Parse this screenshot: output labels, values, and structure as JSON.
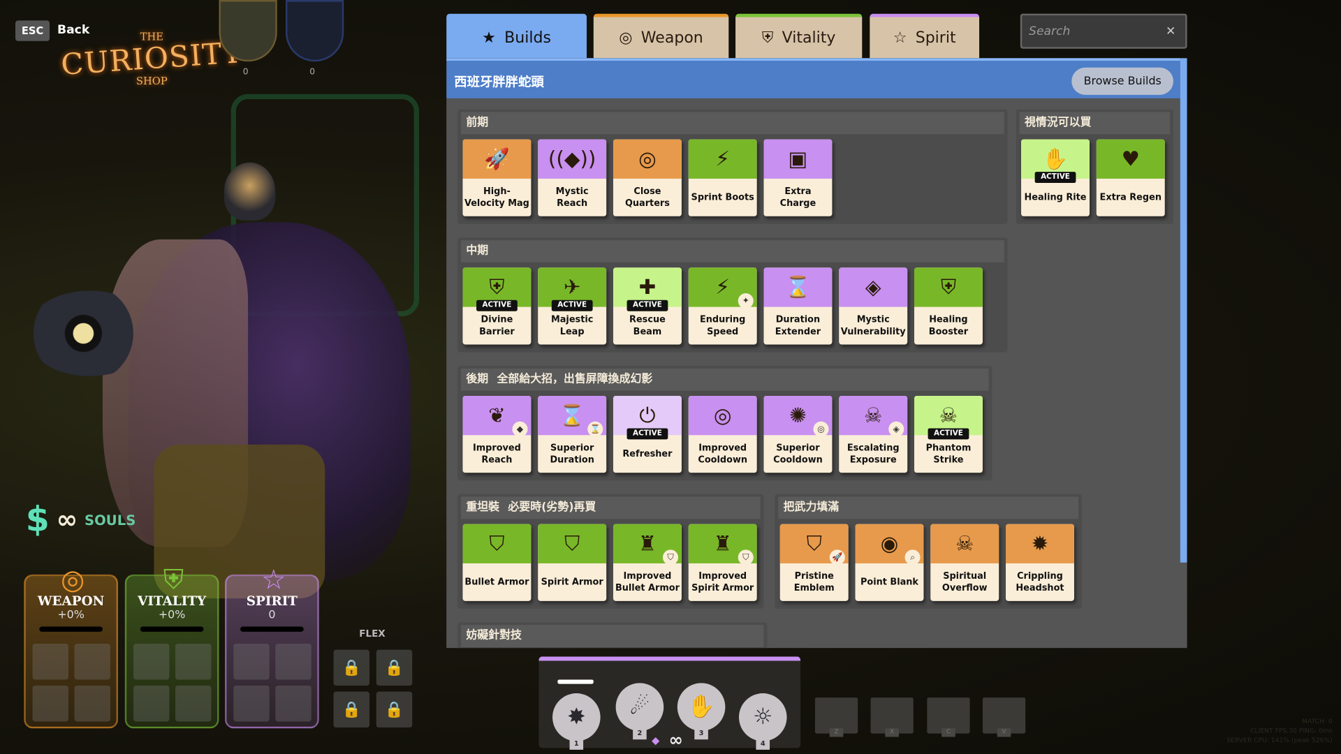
{
  "nav": {
    "esc_key": "ESC",
    "back_label": "Back"
  },
  "logo": {
    "line1": "THE",
    "line2": "CURIOSITY",
    "line3": "SHOP"
  },
  "portraits": [
    {
      "count": "0"
    },
    {
      "count": "0"
    }
  ],
  "hud": {
    "souls_label": "SOULS",
    "flex_label": "FLEX",
    "stats": [
      {
        "name": "WEAPON",
        "value": "+0%",
        "color": "#e8962a"
      },
      {
        "name": "VITALITY",
        "value": "+0%",
        "color": "#7cc23a"
      },
      {
        "name": "SPIRIT",
        "value": "0",
        "color": "#c88ef0"
      }
    ]
  },
  "tabs": [
    {
      "label": "Builds",
      "icon": "star-icon",
      "active": true
    },
    {
      "label": "Weapon",
      "icon": "weapon-icon",
      "color": "#e8962a"
    },
    {
      "label": "Vitality",
      "icon": "vitality-icon",
      "color": "#7cc23a"
    },
    {
      "label": "Spirit",
      "icon": "spirit-icon",
      "color": "#c88ef0"
    }
  ],
  "search": {
    "placeholder": "Search"
  },
  "build": {
    "title": "西班牙胖胖蛇頭",
    "browse_label": "Browse Builds"
  },
  "sections": [
    {
      "title": "前期",
      "note": "",
      "items": [
        {
          "name": "High-Velocity Mag",
          "cat": "w",
          "icon": "🚀"
        },
        {
          "name": "Mystic Reach",
          "cat": "s",
          "icon": "((◆))"
        },
        {
          "name": "Close Quarters",
          "cat": "w",
          "icon": "◎"
        },
        {
          "name": "Sprint Boots",
          "cat": "v",
          "icon": "⚡"
        },
        {
          "name": "Extra Charge",
          "cat": "s",
          "icon": "▣"
        }
      ]
    },
    {
      "title": "視情況可以買",
      "note": "",
      "items": [
        {
          "name": "Healing Rite",
          "cat": "v",
          "icon": "✋",
          "active": true,
          "light": true
        },
        {
          "name": "Extra Regen",
          "cat": "v",
          "icon": "♥"
        }
      ]
    },
    {
      "title": "中期",
      "note": "",
      "items": [
        {
          "name": "Divine Barrier",
          "cat": "v",
          "icon": "⛨",
          "active": true
        },
        {
          "name": "Majestic Leap",
          "cat": "v",
          "icon": "✈",
          "active": true
        },
        {
          "name": "Rescue Beam",
          "cat": "v",
          "icon": "✚",
          "active": true,
          "light": true
        },
        {
          "name": "Enduring Speed",
          "cat": "v",
          "icon": "⚡",
          "badge": "✦"
        },
        {
          "name": "Duration Extender",
          "cat": "s",
          "icon": "⌛"
        },
        {
          "name": "Mystic Vulnerability",
          "cat": "s",
          "icon": "◈"
        },
        {
          "name": "Healing Booster",
          "cat": "v",
          "icon": "⛨"
        }
      ]
    },
    {
      "title": "後期",
      "note": "全部給大招，出售屏障換成幻影",
      "items": [
        {
          "name": "Improved Reach",
          "cat": "s",
          "icon": "❦",
          "badge": "◆"
        },
        {
          "name": "Superior Duration",
          "cat": "s",
          "icon": "⌛",
          "badge": "⌛"
        },
        {
          "name": "Refresher",
          "cat": "s",
          "icon": "⏻",
          "active": true,
          "light": true
        },
        {
          "name": "Improved Cooldown",
          "cat": "s",
          "icon": "◎"
        },
        {
          "name": "Superior Cooldown",
          "cat": "s",
          "icon": "✺",
          "badge": "◎"
        },
        {
          "name": "Escalating Exposure",
          "cat": "s",
          "icon": "☠",
          "badge": "◈"
        },
        {
          "name": "Phantom Strike",
          "cat": "v",
          "icon": "☠",
          "active": true,
          "light": true
        }
      ]
    },
    {
      "title": "重坦裝",
      "note": "必要時(劣勢)再買",
      "items": [
        {
          "name": "Bullet Armor",
          "cat": "v",
          "icon": "⛉"
        },
        {
          "name": "Spirit Armor",
          "cat": "v",
          "icon": "⛉"
        },
        {
          "name": "Improved Bullet Armor",
          "cat": "v",
          "icon": "♜",
          "badge": "⛉"
        },
        {
          "name": "Improved Spirit Armor",
          "cat": "v",
          "icon": "♜",
          "badge": "⛉"
        }
      ]
    },
    {
      "title": "把武力填滿",
      "note": "",
      "items": [
        {
          "name": "Pristine Emblem",
          "cat": "w",
          "icon": "⛉",
          "badge": "🚀"
        },
        {
          "name": "Point Blank",
          "cat": "w",
          "icon": "◉",
          "badge": "⌕"
        },
        {
          "name": "Spiritual Overflow",
          "cat": "w",
          "icon": "☠"
        },
        {
          "name": "Crippling Headshot",
          "cat": "w",
          "icon": "✹"
        }
      ]
    },
    {
      "title": "妨礙針對技",
      "note": "",
      "items": []
    }
  ],
  "abilities": [
    {
      "key": "1",
      "icon": "✸"
    },
    {
      "key": "2",
      "icon": "☄"
    },
    {
      "key": "3",
      "icon": "✋"
    },
    {
      "key": "4",
      "icon": "☼"
    }
  ],
  "hotkeys": [
    "Z",
    "X",
    "C",
    "V"
  ],
  "net_stats": [
    "MATCH: 0",
    "CLIENT FPS:30   PING: 0ms",
    "SERVER CPU: 141% (peak 526%)"
  ]
}
